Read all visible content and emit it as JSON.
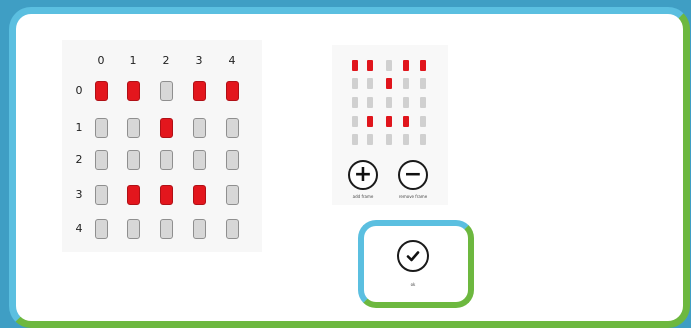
{
  "grid": {
    "col_labels": [
      "0",
      "1",
      "2",
      "3",
      "4"
    ],
    "row_labels": [
      "0",
      "1",
      "2",
      "3",
      "4"
    ],
    "cells": [
      [
        1,
        1,
        0,
        1,
        1
      ],
      [
        0,
        0,
        1,
        0,
        0
      ],
      [
        0,
        0,
        0,
        0,
        0
      ],
      [
        0,
        1,
        1,
        1,
        0
      ],
      [
        0,
        0,
        0,
        0,
        0
      ]
    ]
  },
  "preview": {
    "cells": [
      [
        1,
        1,
        0,
        1,
        1
      ],
      [
        0,
        0,
        1,
        0,
        0
      ],
      [
        0,
        0,
        0,
        0,
        0
      ],
      [
        0,
        1,
        1,
        1,
        0
      ],
      [
        0,
        0,
        0,
        0,
        0
      ]
    ]
  },
  "buttons": {
    "add_frame_label": "add frame",
    "remove_frame_label": "remove frame",
    "ok_label": "ok"
  },
  "colors": {
    "on": "#e3161d",
    "off": "#d7d7d7",
    "frame_blue": "#5bbfe0",
    "frame_green": "#6db83f"
  }
}
